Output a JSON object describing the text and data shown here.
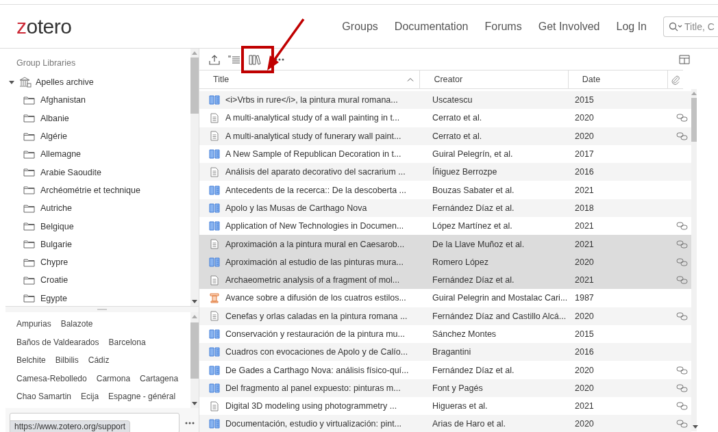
{
  "header": {
    "logo": "zotero",
    "nav": [
      "Groups",
      "Documentation",
      "Forums",
      "Get Involved",
      "Log In"
    ],
    "search": {
      "placeholder": "Title, C"
    }
  },
  "sidebar": {
    "heading": "Group Libraries",
    "library": {
      "name": "Apelles archive",
      "expanded": true,
      "children": [
        {
          "name": "Afghanistan"
        },
        {
          "name": "Albanie"
        },
        {
          "name": "Algérie"
        },
        {
          "name": "Allemagne"
        },
        {
          "name": "Arabie Saoudite"
        },
        {
          "name": "Archéométrie et technique"
        },
        {
          "name": "Autriche"
        },
        {
          "name": "Belgique"
        },
        {
          "name": "Bulgarie"
        },
        {
          "name": "Chypre"
        },
        {
          "name": "Croatie"
        },
        {
          "name": "Egypte"
        }
      ]
    },
    "tags": [
      [
        "Ampurias",
        "Balazote"
      ],
      [
        "Baños de Valdearados",
        "Barcelona"
      ],
      [
        "Belchite",
        "Bilbilis",
        "Cádiz"
      ],
      [
        "Camesa-Rebolledo",
        "Carmona",
        "Cartagena"
      ],
      [
        "Chao Samartin",
        "Ecija",
        "Espagne - général"
      ]
    ],
    "status_tooltip": "https://www.zotero.org/support"
  },
  "items": {
    "columns": [
      {
        "label": "Title",
        "sorted": true
      },
      {
        "label": "Creator",
        "sorted": false
      },
      {
        "label": "Date",
        "sorted": false
      }
    ],
    "rows": [
      {
        "kind": "book",
        "title": "<i>Vrbs in rure</i>, la pintura mural romana...",
        "creator": "Uscatescu",
        "date": "2015",
        "link": false,
        "selected": false
      },
      {
        "kind": "document",
        "title": "A multi-analytical study of a wall painting in t...",
        "creator": "Cerrato et al.",
        "date": "2020",
        "link": true,
        "selected": false
      },
      {
        "kind": "document",
        "title": "A multi-analytical study of funerary wall paint...",
        "creator": "Cerrato et al.",
        "date": "2020",
        "link": true,
        "selected": false
      },
      {
        "kind": "book",
        "title": "A New Sample of Republican Decoration in t...",
        "creator": "Guiral Pelegrín, et al.",
        "date": "2017",
        "link": false,
        "selected": false
      },
      {
        "kind": "document",
        "title": "Análisis del aparato decorativo del sacrarium ...",
        "creator": "Íñiguez Berrozpe",
        "date": "2016",
        "link": false,
        "selected": false
      },
      {
        "kind": "book",
        "title": "Antecedents de la recerca:: De la descoberta ...",
        "creator": "Bouzas Sabater et al.",
        "date": "2021",
        "link": false,
        "selected": false
      },
      {
        "kind": "book",
        "title": "Apolo y las Musas de Carthago Nova",
        "creator": "Fernández Díaz et al.",
        "date": "2018",
        "link": false,
        "selected": false
      },
      {
        "kind": "book",
        "title": "Application of New Technologies in Documen...",
        "creator": "López Martínez et al.",
        "date": "2021",
        "link": true,
        "selected": false
      },
      {
        "kind": "document",
        "title": "Aproximación a la pintura mural en Caesarob...",
        "creator": "De la Llave Muñoz et al.",
        "date": "2021",
        "link": true,
        "selected": true
      },
      {
        "kind": "book",
        "title": "Aproximación al estudio de las pinturas mura...",
        "creator": "Romero López",
        "date": "2020",
        "link": true,
        "selected": true
      },
      {
        "kind": "document",
        "title": "Archaeometric analysis of a fragment of mol...",
        "creator": "Fernández Díaz et al.",
        "date": "2021",
        "link": true,
        "selected": true
      },
      {
        "kind": "presentation",
        "title": "Avance sobre a difusión de los cuatros estilos...",
        "creator": "Guiral Pelegrin and Mostalac Cari...",
        "date": "1987",
        "link": false,
        "selected": false
      },
      {
        "kind": "document",
        "title": "Cenefas y orlas caladas en la pintura romana ...",
        "creator": "Fernández Díaz and Castillo Alcá...",
        "date": "2020",
        "link": true,
        "selected": false
      },
      {
        "kind": "book",
        "title": "Conservación y restauración de la pintura mu...",
        "creator": "Sánchez Montes",
        "date": "2015",
        "link": false,
        "selected": false
      },
      {
        "kind": "book",
        "title": "Cuadros con evocaciones de Apolo y de Calío...",
        "creator": "Bragantini",
        "date": "2016",
        "link": false,
        "selected": false
      },
      {
        "kind": "book",
        "title": "De Gades a Carthago Nova: análisis físico-quí...",
        "creator": "Fernández Díaz et al.",
        "date": "2020",
        "link": true,
        "selected": false
      },
      {
        "kind": "book",
        "title": "Del fragmento al panel expuesto: pinturas m...",
        "creator": "Font y Pagés",
        "date": "2020",
        "link": true,
        "selected": false
      },
      {
        "kind": "document",
        "title": "Digital 3D modeling using photogrammetry ...",
        "creator": "Higueras et al.",
        "date": "2021",
        "link": true,
        "selected": false
      },
      {
        "kind": "book",
        "title": "Documentación, estudio y virtualización: pint...",
        "creator": "Arias de Haro et al.",
        "date": "2020",
        "link": true,
        "selected": false
      }
    ]
  }
}
